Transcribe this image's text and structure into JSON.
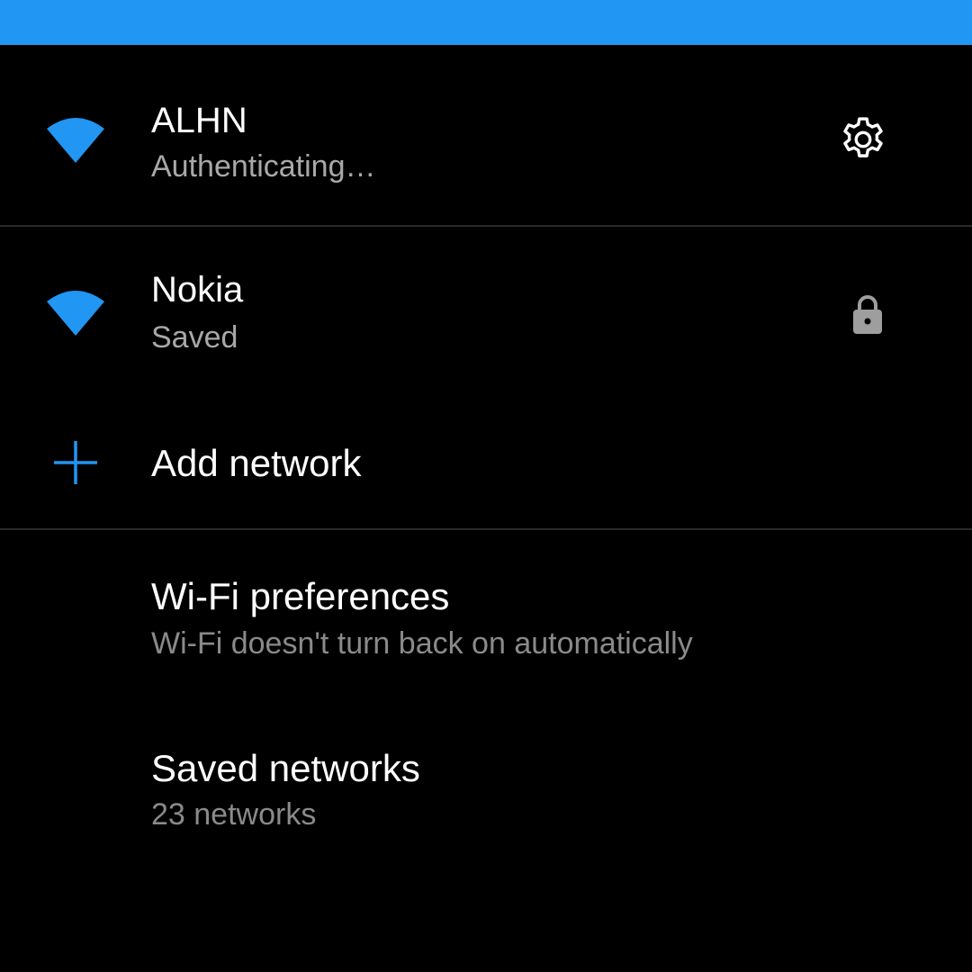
{
  "colors": {
    "accent": "#2196f3",
    "background": "#000000",
    "title": "#ffffff",
    "subtitle": "#a8a8a8",
    "lock": "#9e9e9e"
  },
  "networks": [
    {
      "ssid": "ALHN",
      "status": "Authenticating…",
      "signal_icon": "wifi-signal-icon",
      "trailing_icon": "gear-icon"
    },
    {
      "ssid": "Nokia",
      "status": "Saved",
      "signal_icon": "wifi-signal-icon",
      "trailing_icon": "lock-icon"
    }
  ],
  "add_network": {
    "label": "Add network",
    "icon": "plus-icon"
  },
  "preferences": {
    "label": "Wi‑Fi preferences",
    "summary": "Wi‑Fi doesn't turn back on automatically"
  },
  "saved_networks": {
    "label": "Saved networks",
    "summary": "23 networks"
  }
}
